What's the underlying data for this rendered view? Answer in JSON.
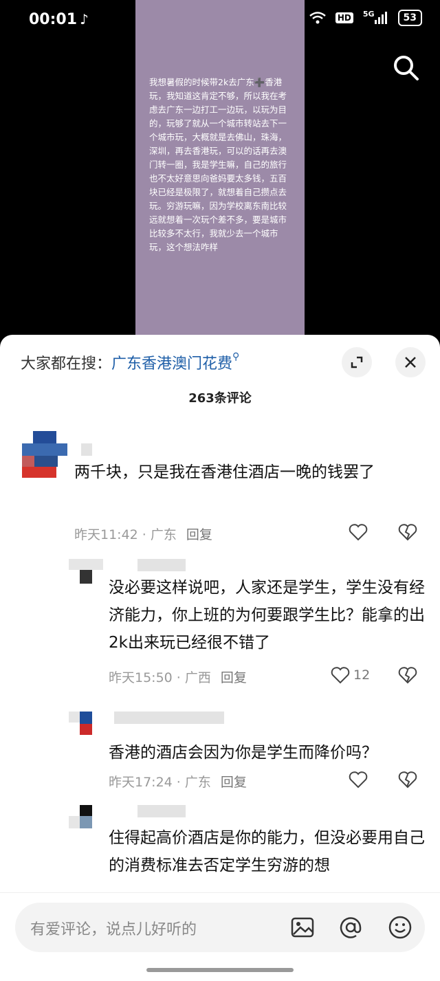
{
  "status": {
    "time": "00:01",
    "battery": "53",
    "hd": "HD",
    "net": "5G"
  },
  "video": {
    "text": "我想暑假的时候带2k去广东➕香港玩，我知道这肯定不够，所以我在考虑去广东一边打工一边玩，以玩为目的，玩够了就从一个城市转站去下一个城市玩，大概就是去佛山，珠海，深圳，再去香港玩，可以的话再去澳门转一圈，我是学生嘛，自己的旅行也不太好意思向爸妈要太多钱，五百块已经是极限了，就想着自己攒点去玩。穷游玩嘛，因为学校离东南比较远就想着一次玩个差不多，要是城市比较多不太行，我就少去一个城市玩，这个想法咋样"
  },
  "sheet": {
    "trend_prefix": "大家都在搜：",
    "trend_keyword": "广东香港澳门花费",
    "comment_count": "263条评论"
  },
  "comments": [
    {
      "text": "两千块，只是我在香港住酒店一晚的钱罢了",
      "time": "昨天11:42 · 广东",
      "reply": "回复",
      "likes": ""
    },
    {
      "text": "没必要这样说吧，人家还是学生，学生没有经济能力，你上班的为何要跟学生比？能拿的出2k出来玩已经很不错了",
      "time": "昨天15:50 · 广西",
      "reply": "回复",
      "likes": "12"
    },
    {
      "text": "香港的酒店会因为你是学生而降价吗？",
      "time": "昨天17:24 · 广东",
      "reply": "回复",
      "likes": ""
    },
    {
      "text": "住得起高价酒店是你的能力，但没必要用自己的消费标准去否定学生穷游的想",
      "time": "",
      "reply": "",
      "likes": ""
    }
  ],
  "input": {
    "placeholder": "有爱评论，说点儿好听的"
  },
  "colors": {
    "video_bg": "#9c8aa8",
    "keyword": "#1f5fa8"
  }
}
